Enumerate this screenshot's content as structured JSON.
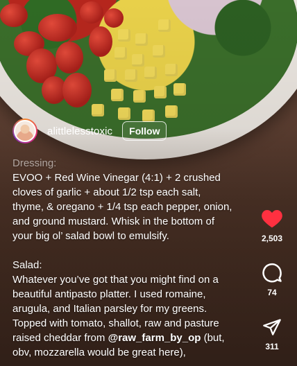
{
  "post": {
    "username": "alittlelesstoxic",
    "follow_label": "Follow"
  },
  "caption": {
    "dressing_heading": "Dressing:",
    "dressing_lines": [
      "EVOO + Red Wine Vinegar (4:1) + 2 crushed",
      "cloves of garlic + about 1/2 tsp each salt,",
      "thyme, & oregano + 1/4 tsp each pepper, onion,",
      "and ground mustard. Whisk in the bottom of",
      "your big ol’ salad bowl to emulsify."
    ],
    "salad_heading": "Salad:",
    "salad_lines": [
      "Whatever you’ve got that you might find on a",
      "beautiful antipasto platter. I used romaine,",
      "arugula, and Italian parsley for my greens.",
      "Topped with tomato, shallot, raw and pasture"
    ],
    "last_line_before": "raised cheddar from ",
    "mention": "@raw_farm_by_op",
    "last_line_after": " (but,",
    "final_line": "obv, mozzarella would be great here),"
  },
  "actions": {
    "likes": "2,503",
    "comments": "74",
    "shares": "311",
    "like_color": "#ff3040"
  },
  "icons": {
    "like": "heart-icon",
    "comment": "comment-bubble-icon",
    "share": "paper-plane-icon"
  }
}
